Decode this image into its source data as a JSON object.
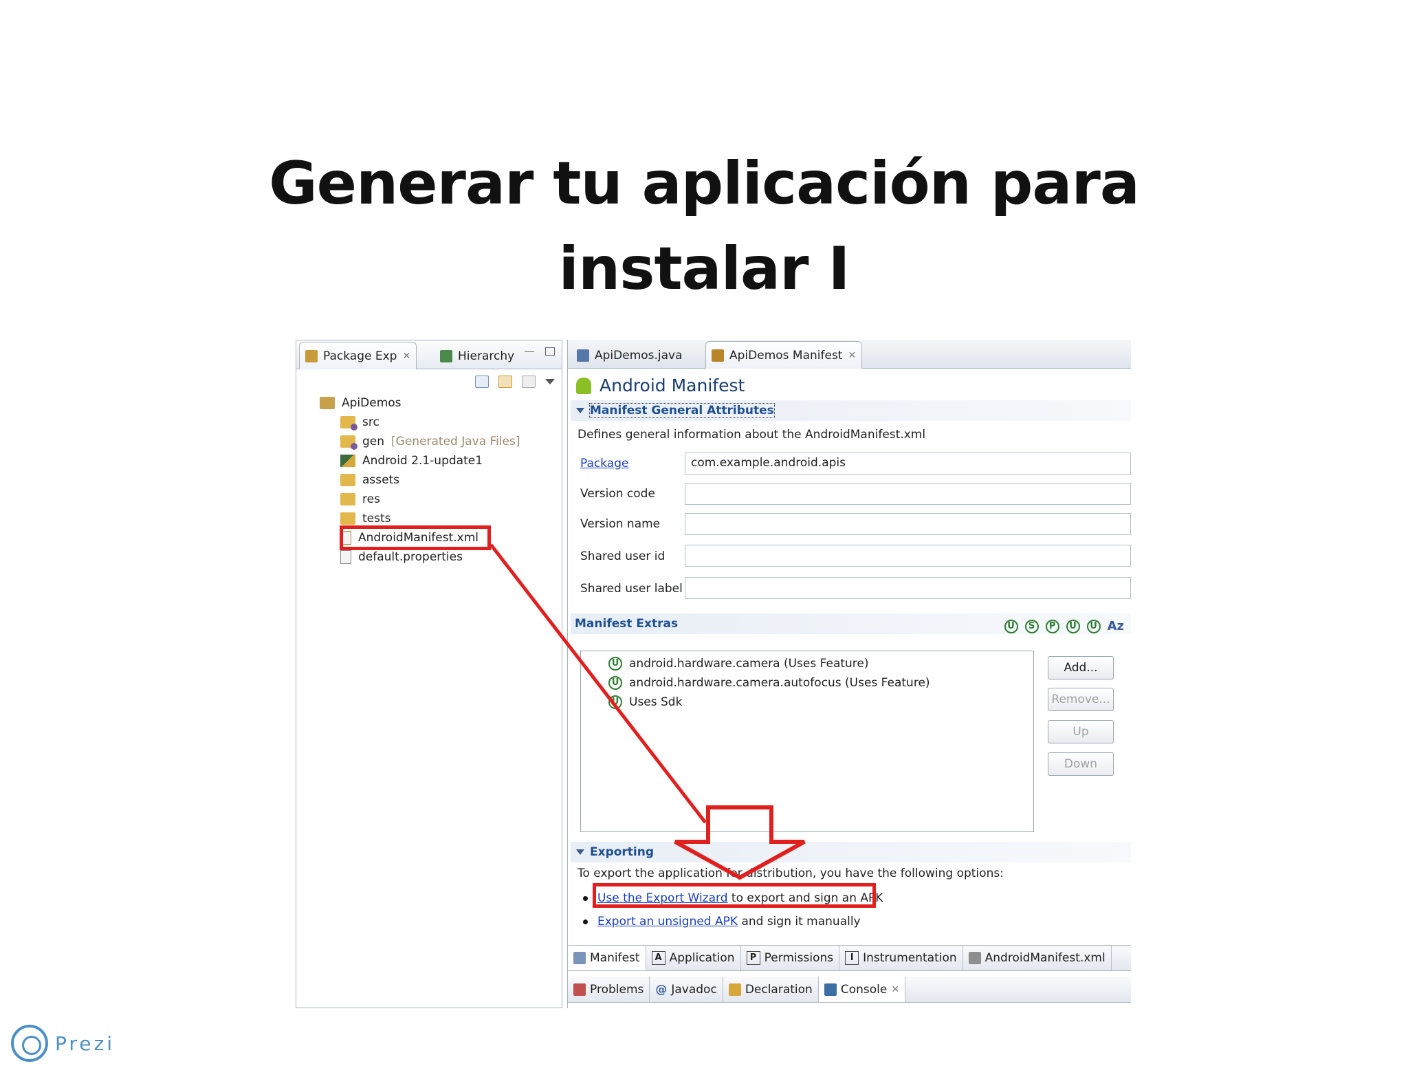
{
  "slide": {
    "title_line1": "Generar tu aplicación para",
    "title_line2": "instalar I"
  },
  "left_pane": {
    "tabs": [
      {
        "label": "Package Exp",
        "icon": "package-explorer-icon"
      },
      {
        "label": "Hierarchy",
        "icon": "hierarchy-icon"
      }
    ],
    "tree": [
      {
        "label": "ApiDemos",
        "icon": "project-icon"
      },
      {
        "label": "src",
        "icon": "source-folder-icon"
      },
      {
        "label": "gen",
        "suffix": "[Generated Java Files]",
        "icon": "source-folder-icon"
      },
      {
        "label": "Android 2.1-update1",
        "icon": "library-icon"
      },
      {
        "label": "assets",
        "icon": "folder-icon"
      },
      {
        "label": "res",
        "icon": "folder-icon"
      },
      {
        "label": "tests",
        "icon": "folder-icon"
      },
      {
        "label": "AndroidManifest.xml",
        "icon": "xml-file-icon"
      },
      {
        "label": "default.properties",
        "icon": "properties-file-icon"
      }
    ]
  },
  "editor": {
    "tabs": [
      {
        "label": "ApiDemos.java",
        "icon": "java-file-icon"
      },
      {
        "label": "ApiDemos Manifest",
        "icon": "manifest-icon"
      }
    ],
    "form_title": "Android Manifest",
    "general": {
      "heading": "Manifest General Attributes",
      "description": "Defines general information about the AndroidManifest.xml",
      "fields": [
        {
          "label": "Package",
          "value": "com.example.android.apis"
        },
        {
          "label": "Version code",
          "value": ""
        },
        {
          "label": "Version name",
          "value": ""
        },
        {
          "label": "Shared user id",
          "value": ""
        },
        {
          "label": "Shared user label",
          "value": ""
        }
      ]
    },
    "extras": {
      "heading": "Manifest Extras",
      "icon_letters": [
        "U",
        "S",
        "P",
        "U",
        "U",
        "Az"
      ],
      "items": [
        "android.hardware.camera (Uses Feature)",
        "android.hardware.camera.autofocus (Uses Feature)",
        "Uses Sdk"
      ],
      "buttons": {
        "add": "Add...",
        "remove": "Remove...",
        "up": "Up",
        "down": "Down"
      }
    },
    "exporting": {
      "heading": "Exporting",
      "intro": "To export the application for distribution, you have the following options:",
      "option1_link": "Use the Export Wizard",
      "option1_rest": "to export and sign an APK",
      "option2_link": "Export an unsigned APK",
      "option2_rest": "and sign it manually"
    },
    "page_tabs": [
      {
        "label": "Manifest",
        "badge": ""
      },
      {
        "label": "Application",
        "badge": "A"
      },
      {
        "label": "Permissions",
        "badge": "P"
      },
      {
        "label": "Instrumentation",
        "badge": "I"
      },
      {
        "label": "AndroidManifest.xml",
        "badge": ""
      }
    ],
    "view_tabs": [
      "Problems",
      "Javadoc",
      "Declaration",
      "Console"
    ]
  },
  "footer": {
    "brand": "Prezi"
  },
  "colors": {
    "highlight": "#e0201f",
    "link": "#1a3fbf",
    "section_text": "#1d4f91"
  }
}
